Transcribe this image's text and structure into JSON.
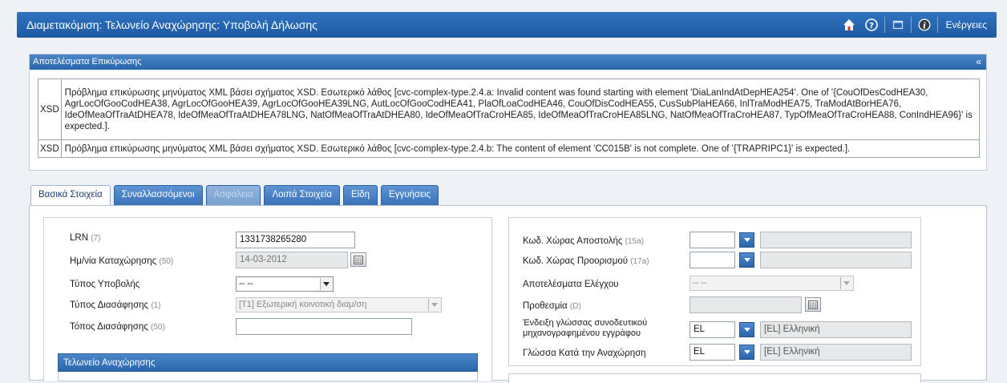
{
  "window": {
    "title": "Διαμετακόμιση: Τελωνείο Αναχώρησης: Υποβολή Δήλωσης",
    "actions_label": "Ενέργειες",
    "icons": [
      "home-icon",
      "help-icon",
      "window-icon",
      "info-icon"
    ]
  },
  "results": {
    "title": "Αποτελέσματα Επικύρωσης",
    "collapse_glyph": "«",
    "messages": [
      {
        "code": "XSD",
        "text": "Πρόβλημα επικύρωσης μηνύματος XML βάσει σχήματος XSD. Εσωτερικό λάθος [cvc-complex-type.2.4.a: Invalid content was found starting with element 'DiaLanIndAtDepHEA254'. One of '{CouOfDesCodHEA30, AgrLocOfGooCodHEA38, AgrLocOfGooHEA39, AgrLocOfGooHEA39LNG, AutLocOfGooCodHEA41, PlaOfLoaCodHEA46, CouOfDisCodHEA55, CusSubPlaHEA66, InlTraModHEA75, TraModAtBorHEA76, IdeOfMeaOfTraAtDHEA78, IdeOfMeaOfTraAtDHEA78LNG, NatOfMeaOfTraAtDHEA80, IdeOfMeaOfTraCroHEA85, IdeOfMeaOfTraCroHEA85LNG, NatOfMeaOfTraCroHEA87, TypOfMeaOfTraCroHEA88, ConIndHEA96}' is expected.]."
      },
      {
        "code": "XSD",
        "text": "Πρόβλημα επικύρωσης μηνύματος XML βάσει σχήματος XSD. Εσωτερικό λάθος [cvc-complex-type.2.4.b: The content of element 'CC015B' is not complete. One of '{TRAPRIPC1}' is expected.]."
      }
    ]
  },
  "tabs": [
    {
      "label": "Βασικά Στοιχεία",
      "state": "active"
    },
    {
      "label": "Συναλλασσόμενοι",
      "state": "normal"
    },
    {
      "label": "Ασφάλεια",
      "state": "disabled"
    },
    {
      "label": "Λοιπά Στοιχεία",
      "state": "normal"
    },
    {
      "label": "Είδη",
      "state": "normal"
    },
    {
      "label": "Εγγυήσεις",
      "state": "normal"
    }
  ],
  "left_form": {
    "lrn": {
      "label": "LRN",
      "note": "(7)",
      "value": "1331738265280"
    },
    "reg_date": {
      "label": "Ημ/νία Καταχώρησης",
      "note": "(50)",
      "value": "14-03-2012"
    },
    "submission_type": {
      "label": "Τύπος Υποβολής",
      "value": "-- --"
    },
    "declaration_type": {
      "label": "Τύπος Διασάφησης",
      "note": "(1)",
      "value": "[T1] Εξωτερική κοινοτική διαμ/ση"
    },
    "declaration_place": {
      "label": "Τόπος Διασάφησης",
      "note": "(50)",
      "value": ""
    },
    "departure_office_title": "Τελωνείο Αναχώρησης"
  },
  "right_form": {
    "dispatch_country": {
      "label": "Κωδ. Χώρας Αποστολής",
      "note": "(15a)",
      "code": "",
      "name": ""
    },
    "destination_country": {
      "label": "Κωδ. Χώρας Προορισμού",
      "note": "(17a)",
      "code": "",
      "name": ""
    },
    "control_results": {
      "label": "Αποτελέσματα Ελέγχου",
      "value": "-- --"
    },
    "deadline": {
      "label": "Προθεσμία",
      "note": "(D)",
      "value": ""
    },
    "doc_language": {
      "label_line1": "Ένδειξη γλώσσας συνοδευτικού",
      "label_line2": "μηχανογραφημένου εγγράφου",
      "code": "EL",
      "name": "[EL] Ελληνική"
    },
    "departure_language": {
      "label": "Γλώσσα Κατά την Αναχώρηση",
      "code": "EL",
      "name": "[EL] Ελληνική"
    }
  }
}
